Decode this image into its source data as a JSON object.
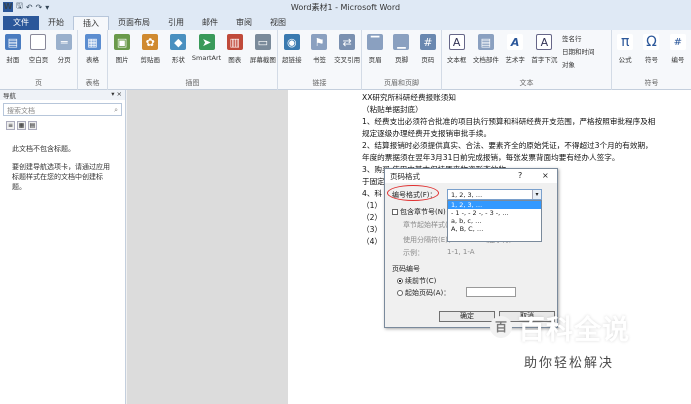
{
  "window": {
    "title": "Word素材1 - Microsoft Word"
  },
  "qat": {
    "undo_icon": "undo-icon",
    "redo_icon": "redo-icon",
    "save_icon": "save-icon"
  },
  "tabs": [
    {
      "label": "文件"
    },
    {
      "label": "开始"
    },
    {
      "label": "插入"
    },
    {
      "label": "页面布局"
    },
    {
      "label": "引用"
    },
    {
      "label": "邮件"
    },
    {
      "label": "审阅"
    },
    {
      "label": "视图"
    }
  ],
  "ribbon": {
    "pages": {
      "label": "页",
      "buttons": [
        "封面",
        "空白页",
        "分页"
      ]
    },
    "tables": {
      "label": "表格",
      "buttons": [
        "表格"
      ]
    },
    "illustrations": {
      "label": "插图",
      "buttons": [
        "图片",
        "剪贴画",
        "形状",
        "SmartArt",
        "图表",
        "屏幕截图"
      ]
    },
    "links": {
      "label": "链接",
      "buttons": [
        "超链接",
        "书签",
        "交叉引用"
      ]
    },
    "header_footer": {
      "label": "页眉和页脚",
      "buttons": [
        "页眉",
        "页脚",
        "页码"
      ]
    },
    "text": {
      "label": "文本",
      "buttons": [
        "文本框",
        "文档部件",
        "艺术字",
        "首字下沉"
      ],
      "small": [
        "签名行",
        "日期和时间",
        "对象"
      ]
    },
    "symbols": {
      "label": "符号",
      "buttons": [
        "公式",
        "符号",
        "编号"
      ]
    }
  },
  "nav": {
    "title": "导航",
    "search_placeholder": "搜索文档",
    "message1": "此文档不包含标题。",
    "message2": "要创建导航选项卡，请通过应用标题样式在您的文档中创建标题。"
  },
  "document": {
    "lines": [
      "XX研究所科研经费报账须知",
      "（粘贴单据封底）",
      "1、经费支出必须符合批准的项目执行预算和科研经费开支范围，严格按照审批程序及相",
      "规定逐级办理经费开支报销审批手续。",
      "2、结算报销时必须提供真实、合法、要素齐全的原始凭证，不得超过3个月的有效期，",
      "年度的票据须在翌年3月31日前完成报销，每张发票背面均要有经办人签字。",
      "3、购买                                                          使用中基本保持原来物资形态的物",
      "于固定                                                          资产增（减）报告单》。",
      "4、科",
      "（1）",
      "（2）                                                          审批。",
      "（3）",
      "（4）"
    ]
  },
  "dialog": {
    "title": "页码格式",
    "help": "?",
    "close": "×",
    "format_label": "编号格式(F)：",
    "format_value": "1, 2, 3, …",
    "dropdown_options": [
      "1, 2, 3, …",
      "- 1 -, - 2 -, - 3 -, …",
      "a, b, c, …",
      "A, B, C, …"
    ],
    "include_chapter": "包含章节号(N)",
    "chapter_style": "章节起始样式(P)：",
    "separator": "使用分隔符(E)：",
    "separator_value": "（连字符）",
    "example_label": "示例：",
    "example_value": "1-1, 1-A",
    "page_numbering": "页码编号",
    "continue": "续前节(C)",
    "start_at": "起始页码(A)：",
    "ok": "确定",
    "cancel": "取消"
  },
  "watermark": {
    "title": "百科全说",
    "subtitle": "助你轻松解决"
  }
}
